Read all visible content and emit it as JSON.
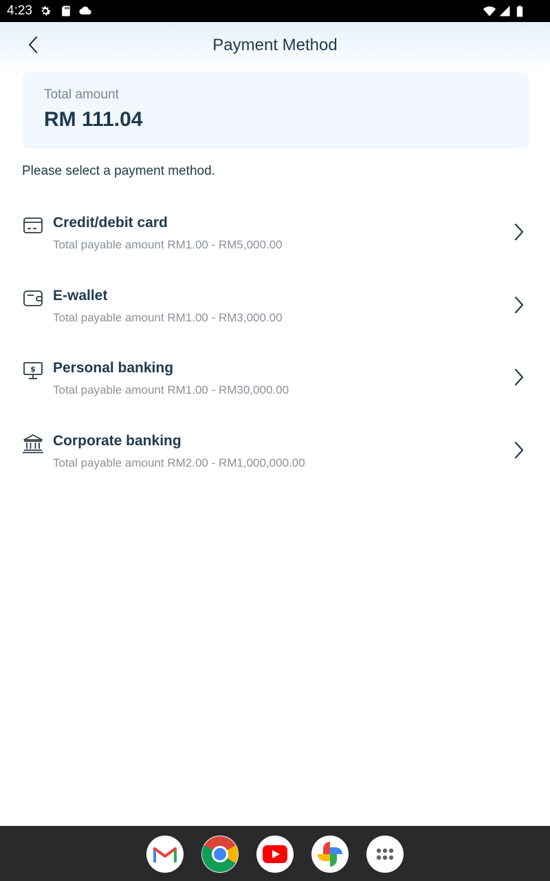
{
  "status_bar": {
    "time": "4:23",
    "left_icons": [
      "gear-icon",
      "sd-card-icon",
      "cloud-icon"
    ],
    "right_icons": [
      "wifi-icon",
      "cellular-signal-icon",
      "battery-icon"
    ]
  },
  "header": {
    "title": "Payment Method",
    "back_icon": "chevron-left-icon"
  },
  "total": {
    "label": "Total amount",
    "value": "RM 111.04"
  },
  "instruction": "Please select a payment method.",
  "methods": [
    {
      "title": "Credit/debit card",
      "subtitle": "Total payable amount RM1.00 - RM5,000.00",
      "icon": "credit-card-icon"
    },
    {
      "title": "E-wallet",
      "subtitle": "Total payable amount RM1.00 - RM3,000.00",
      "icon": "wallet-icon"
    },
    {
      "title": "Personal banking",
      "subtitle": "Total payable amount RM1.00 - RM30,000.00",
      "icon": "computer-dollar-icon"
    },
    {
      "title": "Corporate banking",
      "subtitle": "Total payable amount RM2.00 - RM1,000,000.00",
      "icon": "bank-icon"
    }
  ],
  "dock": {
    "apps": [
      "gmail-icon",
      "chrome-icon",
      "youtube-icon",
      "photos-icon",
      "app-drawer-icon"
    ]
  },
  "colors": {
    "primary_text": "#1d3a50",
    "secondary_text": "#8a9199",
    "card_background": "#f1f7fc",
    "header_gradient_top": "#e6f1fb"
  }
}
